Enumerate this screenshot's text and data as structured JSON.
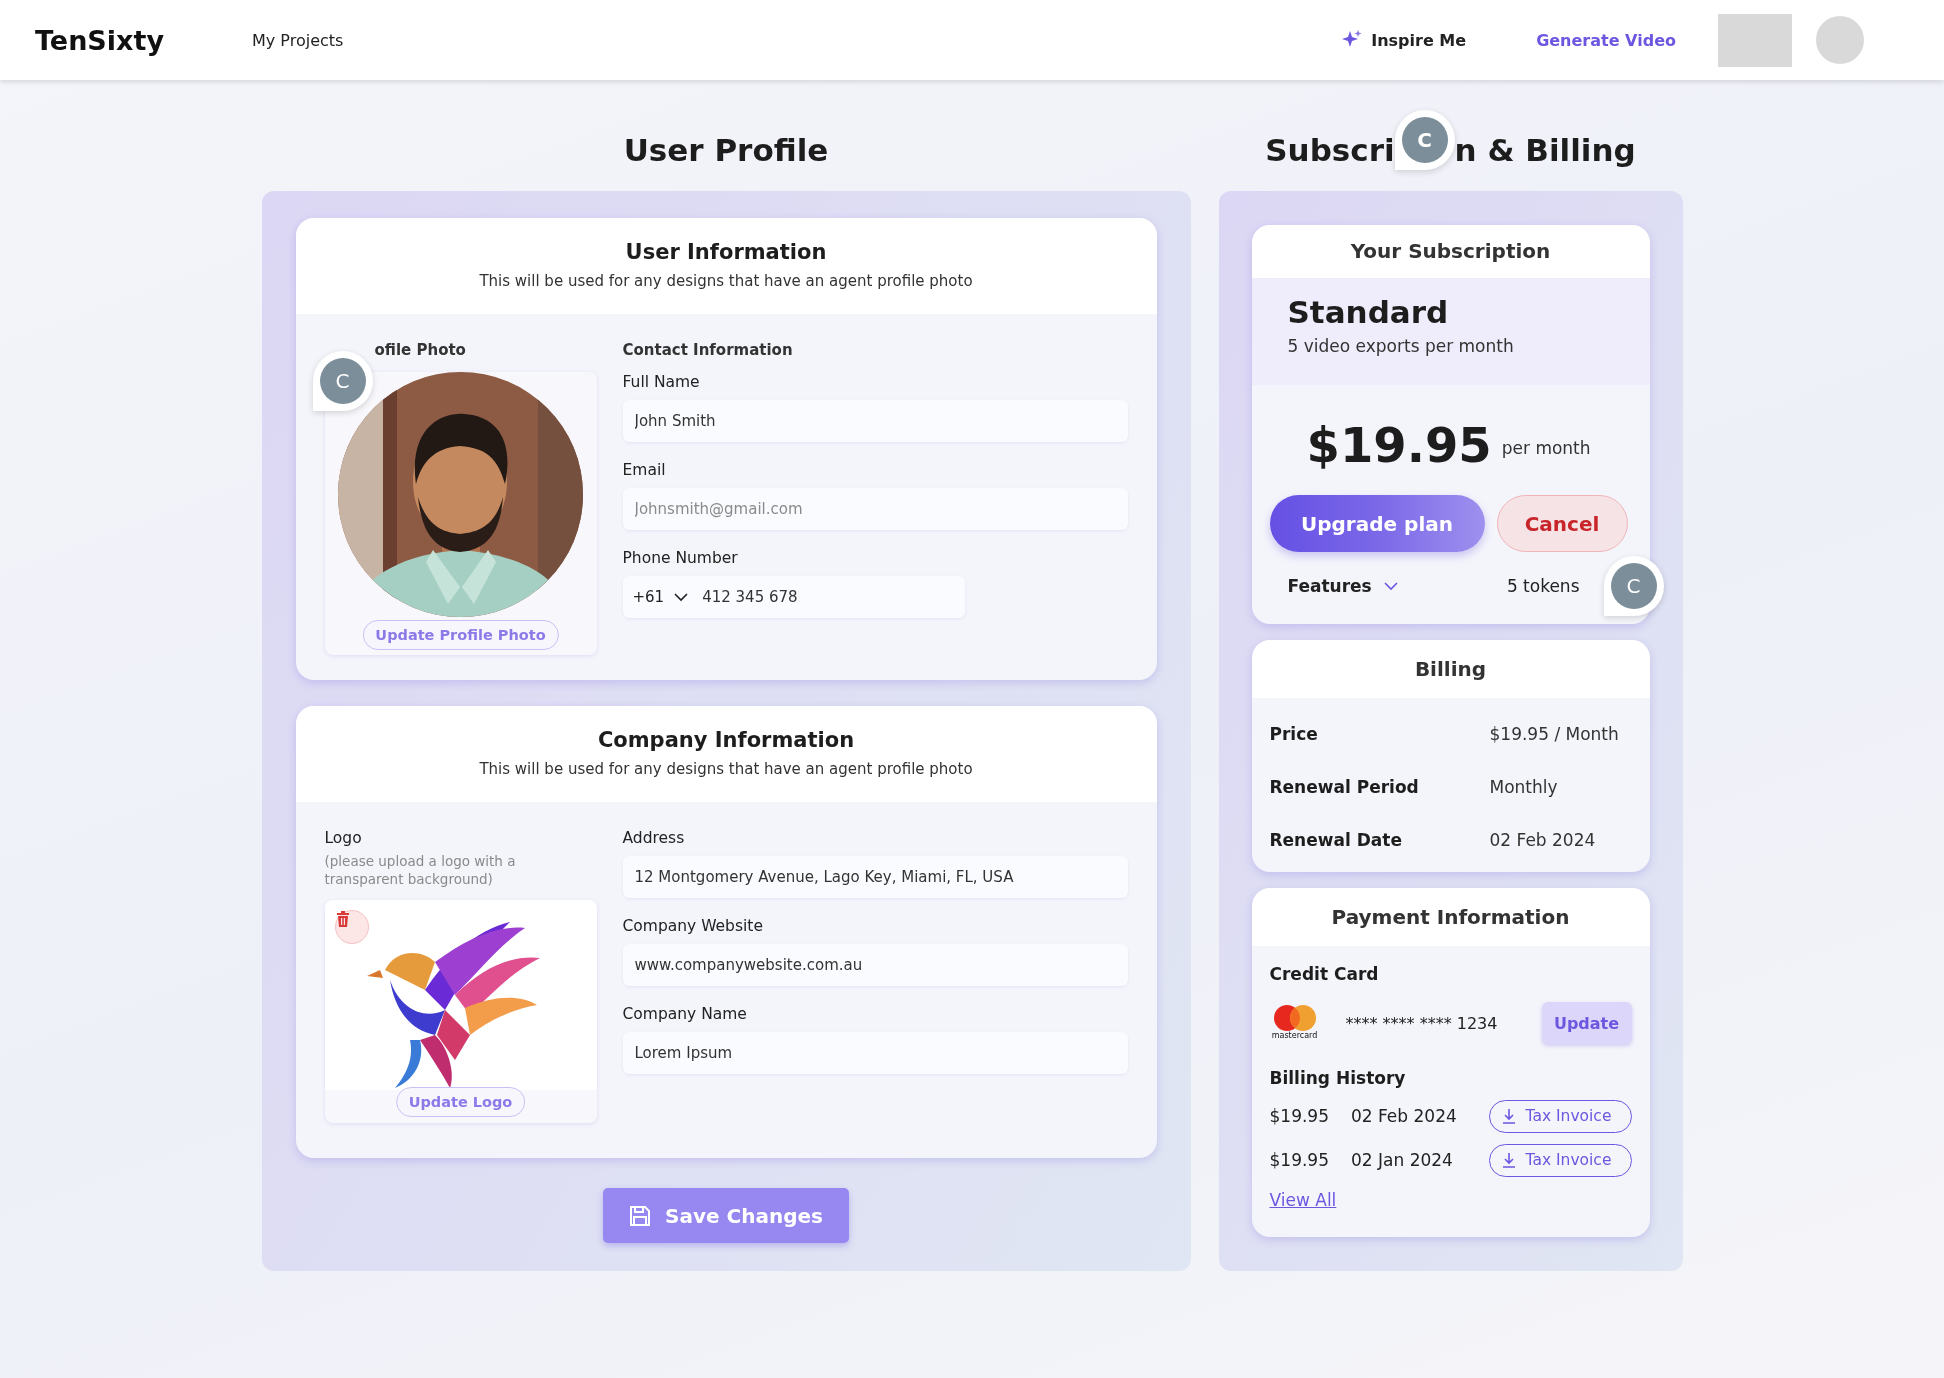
{
  "header": {
    "logo": "TenSixty",
    "nav": [
      {
        "label": "My Projects"
      }
    ],
    "inspire": "Inspire Me",
    "generate": "Generate Video"
  },
  "profile": {
    "title": "User Profile",
    "user_info": {
      "title": "User Information",
      "subtitle": "This will be used for any designs that have an agent profile photo",
      "photo_label": "ofile Photo",
      "photo_pin": "C",
      "photo_button": "Update Profile Photo",
      "contact_title": "Contact Information",
      "fields": [
        {
          "kind": "text",
          "label": "Full Name",
          "value": "John Smith"
        },
        {
          "kind": "text",
          "label": "Email",
          "placeholder": "Johnsmith@gmail.com"
        },
        {
          "kind": "phone",
          "label": "Phone Number",
          "country_code": "+61",
          "value": "412 345 678"
        }
      ]
    },
    "company_info": {
      "title": "Company Information",
      "subtitle": "This will be used for any designs that have an agent profile photo",
      "logo_label": "Logo",
      "logo_hint": "(please upload a logo with a transparent background)",
      "logo_button": "Update Logo",
      "fields": [
        {
          "kind": "text",
          "label": "Address",
          "value": "12 Montgomery Avenue, Lago Key, Miami, FL, USA"
        },
        {
          "kind": "text",
          "label": "Company Website",
          "value": "www.companywebsite.com.au"
        },
        {
          "kind": "text",
          "label": "Company Name",
          "value": "Lorem Ipsum"
        }
      ]
    },
    "save_button": "Save Changes"
  },
  "billing_section": {
    "title_parts": [
      "Subscri",
      "n & Billing"
    ],
    "title_pin": "C",
    "subscription": {
      "title": "Your Subscription",
      "plan": "Standard",
      "plan_note": "5 video exports per month",
      "price": "$19.95",
      "price_unit": "per month",
      "upgrade": "Upgrade plan",
      "cancel": "Cancel",
      "features": "Features",
      "tokens": "5 tokens",
      "tokens_pin": "C"
    },
    "billing": {
      "title": "Billing",
      "rows": [
        {
          "label": "Price",
          "value": "$19.95 / Month"
        },
        {
          "label": "Renewal Period",
          "value": "Monthly"
        },
        {
          "label": "Renewal Date",
          "value": "02 Feb 2024"
        }
      ]
    },
    "payment": {
      "title": "Payment Information",
      "card_label": "Credit Card",
      "card_brand": "mastercard",
      "card_number": "**** **** **** 1234",
      "update": "Update",
      "history_title": "Billing History",
      "history": [
        {
          "amount": "$19.95",
          "date": "02 Feb 2024",
          "invoice": "Tax Invoice"
        },
        {
          "amount": "$19.95",
          "date": "02 Jan 2024",
          "invoice": "Tax Invoice"
        }
      ],
      "view_all": "View All"
    }
  }
}
